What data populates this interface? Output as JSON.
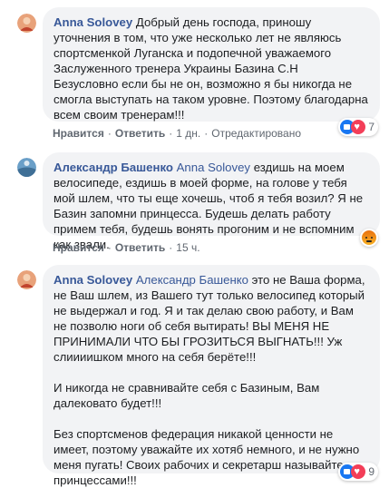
{
  "comments": [
    {
      "author": "Anna Solovey",
      "mention": "",
      "body": [
        "Добрый день господа, приношу уточнения в том, что уже несколько лет не являюсь спортсменкой Луганска и подопечной уважаемого Заслуженного тренера Украины Базина С.Н",
        "Безусловно если бы не он, возможно я бы никогда не смогла выступать на таком уровне. Поэтому благодарна всем своим тренерам!!!"
      ],
      "actions": {
        "like": "Нравится",
        "reply": "Ответить",
        "time": "1 дн.",
        "edited": "Отредактировано"
      },
      "reactions": {
        "types": [
          "like-icon",
          "love-icon"
        ],
        "count": "7"
      }
    },
    {
      "author": "Александр Башенко",
      "mention": "Anna Solovey",
      "body": [
        "ездишь на моем велосипеде, ездишь в моей форме, на голове у тебя мой шлем, что ты еще хочешь, чтоб я тебя возил? Я не Базин запомни принцесса. Будешь делать работу примем тебя, будешь вонять прогоним и не вспомним как звали."
      ],
      "actions": {
        "like": "Нравится",
        "reply": "Ответить",
        "time": "15 ч."
      },
      "reactions": {
        "types": [
          "angry-icon"
        ],
        "count": ""
      }
    },
    {
      "author": "Anna Solovey",
      "mention": "Александр Башенко",
      "body": [
        "это не Ваша форма, не Ваш шлем, из Вашего тут только велосипед который не выдержал и год. Я и так делаю свою работу, и Вам не позволю ноги об себя вытирать! ВЫ МЕНЯ НЕ ПРИНИМАЛИ ЧТО БЫ ГРОЗИТЬСЯ ВЫГНАТЬ!!! Уж слиииишком много на себя берёте!!!",
        "И никогда не сравнивайте себя с Базиным, Вам далековато будет!!!",
        "Без спортсменов федерация никакой ценности не имеет, поэтому уважайте их хотяб немного, и не нужно меня пугать! Своих рабочих и секретарш называйте принцессами!!!"
      ],
      "reactions": {
        "types": [
          "like-icon",
          "love-icon"
        ],
        "count": "9"
      }
    }
  ]
}
